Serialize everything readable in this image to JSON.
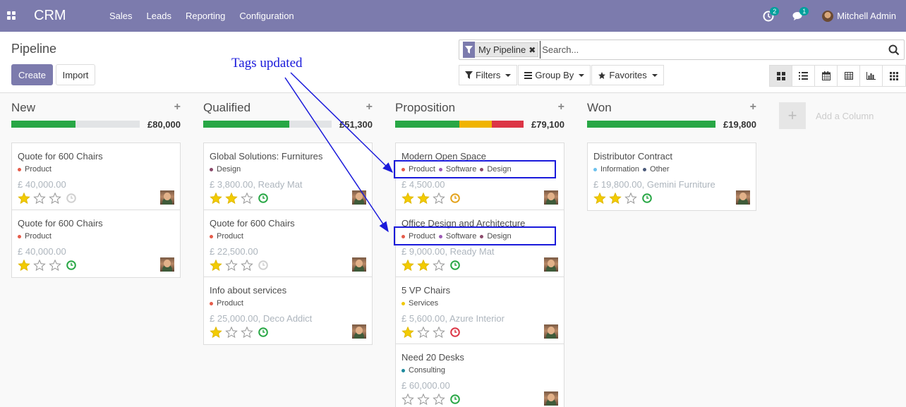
{
  "navbar": {
    "brand": "CRM",
    "menu": [
      "Sales",
      "Leads",
      "Reporting",
      "Configuration"
    ],
    "activity_count": "2",
    "message_count": "1",
    "user": "Mitchell Admin"
  },
  "control": {
    "breadcrumb": "Pipeline",
    "create_label": "Create",
    "import_label": "Import",
    "facet_label": "My Pipeline",
    "search_placeholder": "Search...",
    "filters_label": "Filters",
    "groupby_label": "Group By",
    "favorites_label": "Favorites"
  },
  "columns": [
    {
      "title": "New",
      "sum": "£80,000",
      "progress": [
        {
          "color": "#28a745",
          "pct": 50
        }
      ],
      "cards": [
        {
          "title": "Quote for 600 Chairs",
          "tags": [
            {
              "name": "Product",
              "color": "#e55c4a"
            }
          ],
          "amount": "£ 40,000.00",
          "stars": 1,
          "activity": "none"
        },
        {
          "title": "Quote for 600 Chairs",
          "tags": [
            {
              "name": "Product",
              "color": "#e55c4a"
            }
          ],
          "amount": "£ 40,000.00",
          "stars": 1,
          "activity": "green"
        }
      ]
    },
    {
      "title": "Qualified",
      "sum": "£51,300",
      "progress": [
        {
          "color": "#28a745",
          "pct": 67
        }
      ],
      "cards": [
        {
          "title": "Global Solutions: Furnitures",
          "tags": [
            {
              "name": "Design",
              "color": "#8b4a6b"
            }
          ],
          "amount": "£ 3,800.00, Ready Mat",
          "stars": 2,
          "activity": "green"
        },
        {
          "title": "Quote for 600 Chairs",
          "tags": [
            {
              "name": "Product",
              "color": "#e55c4a"
            }
          ],
          "amount": "£ 22,500.00",
          "stars": 1,
          "activity": "none"
        },
        {
          "title": "Info about services",
          "tags": [
            {
              "name": "Product",
              "color": "#e55c4a"
            }
          ],
          "amount": "£ 25,000.00, Deco Addict",
          "stars": 1,
          "activity": "green"
        }
      ]
    },
    {
      "title": "Proposition",
      "sum": "£79,100",
      "progress": [
        {
          "color": "#28a745",
          "pct": 50
        },
        {
          "color": "#f0b400",
          "pct": 25
        },
        {
          "color": "#dc3545",
          "pct": 25
        }
      ],
      "cards": [
        {
          "title": "Modern Open Space",
          "tags": [
            {
              "name": "Product",
              "color": "#e55c4a"
            },
            {
              "name": "Software",
              "color": "#9b59b6"
            },
            {
              "name": "Design",
              "color": "#8b4a6b"
            }
          ],
          "amount": "£ 4,500.00",
          "stars": 2,
          "activity": "orange"
        },
        {
          "title": "Office Design and Architecture",
          "tags": [
            {
              "name": "Product",
              "color": "#e55c4a"
            },
            {
              "name": "Software",
              "color": "#9b59b6"
            },
            {
              "name": "Design",
              "color": "#8b4a6b"
            }
          ],
          "amount": "£ 9,000.00, Ready Mat",
          "stars": 2,
          "activity": "green"
        },
        {
          "title": "5 VP Chairs",
          "tags": [
            {
              "name": "Services",
              "color": "#f0c808"
            }
          ],
          "amount": "£ 5,600.00, Azure Interior",
          "stars": 1,
          "activity": "red"
        },
        {
          "title": "Need 20 Desks",
          "tags": [
            {
              "name": "Consulting",
              "color": "#1f8a9e"
            }
          ],
          "amount": "£ 60,000.00",
          "stars": 0,
          "activity": "green"
        }
      ]
    },
    {
      "title": "Won",
      "sum": "£19,800",
      "progress": [
        {
          "color": "#28a745",
          "pct": 100
        }
      ],
      "cards": [
        {
          "title": "Distributor Contract",
          "tags": [
            {
              "name": "Information",
              "color": "#6cc1ed"
            },
            {
              "name": "Other",
              "color": "#4b5a7a"
            }
          ],
          "amount": "£ 19,800.00, Gemini Furniture",
          "stars": 2,
          "activity": "green"
        }
      ]
    }
  ],
  "add_column_label": "Add a Column",
  "annotation": {
    "text": "Tags updated",
    "color": "#1a1adb"
  }
}
